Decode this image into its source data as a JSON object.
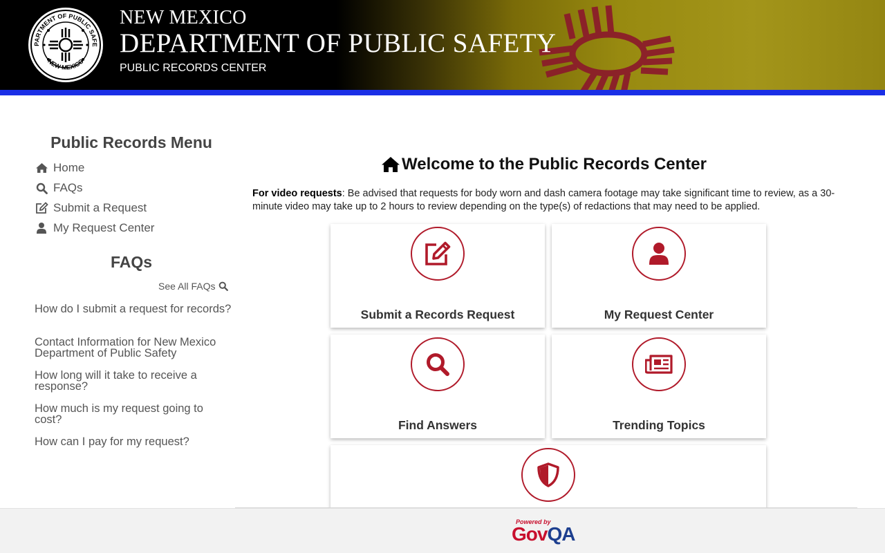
{
  "header": {
    "state": "NEW MEXICO",
    "department": "DEPARTMENT OF PUBLIC SAFETY",
    "subtitle": "PUBLIC RECORDS CENTER",
    "seal": {
      "top_text": "DEPARTMENT OF PUBLIC SAFETY",
      "bottom_text": "NEW MEXICO"
    },
    "colors": {
      "accent_bar": "#1a2fe6",
      "zia_red": "#8b1a2b",
      "flag_gold": "#a3951a"
    }
  },
  "sidebar": {
    "menu_title": "Public Records Menu",
    "menu": [
      {
        "label": "Home",
        "icon": "home-icon"
      },
      {
        "label": "FAQs",
        "icon": "search-icon"
      },
      {
        "label": "Submit a Request",
        "icon": "edit-icon"
      },
      {
        "label": "My Request Center",
        "icon": "user-icon"
      }
    ],
    "faq_title": "FAQs",
    "see_all": "See All FAQs",
    "faqs": [
      "How do I submit a request for records?",
      "Contact Information for New Mexico Department of Public Safety",
      "How long will it take to receive a response?",
      "How much is my request going to cost?",
      "How can I pay for my request?"
    ]
  },
  "main": {
    "welcome": "Welcome to the Public Records Center",
    "notice_bold": "For video requests",
    "notice_text": ": Be advised that requests for body worn and dash camera footage may take significant time to review, as a 30-minute video may take up to 2 hours to review depending on the type(s) of redactions that may need to be applied.",
    "cards": [
      {
        "label": "Submit a Records Request",
        "icon": "edit-icon"
      },
      {
        "label": "My Request Center",
        "icon": "user-icon"
      },
      {
        "label": "Find Answers",
        "icon": "search-icon"
      },
      {
        "label": "Trending Topics",
        "icon": "newspaper-icon"
      },
      {
        "label": "",
        "icon": "shield-icon"
      }
    ],
    "colors": {
      "icon_red": "#b01a2a"
    }
  },
  "footer": {
    "powered_by": "Powered by",
    "brand_gov": "Gov",
    "brand_qa": "QA"
  }
}
